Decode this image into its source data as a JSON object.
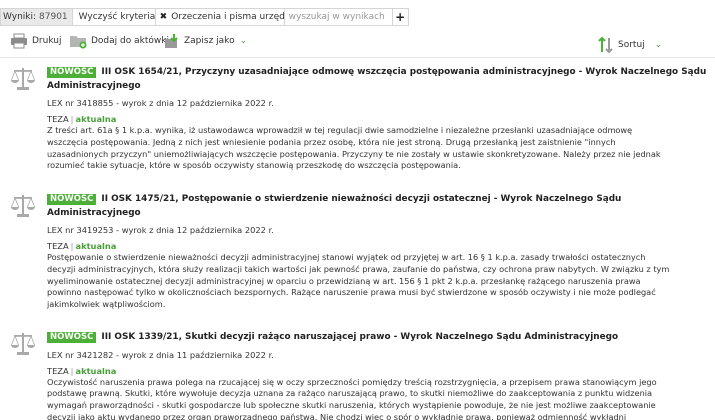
{
  "filterbar": {
    "results_label": "Wyniki:",
    "results_count": "87901",
    "clear_label": "Wyczyść kryteria",
    "tag_label": "Orzeczenia i pisma urzędowe",
    "search_placeholder": "wyszukaj w wynikach",
    "add_label": "+"
  },
  "toolbar": {
    "print_label": "Drukuj",
    "add_label": "Dodaj do aktówki",
    "save_label": "Zapisz jako",
    "sort_label": "Sortuj"
  },
  "results": [
    {
      "badge": "NOWOŚĆ",
      "title_line1": "III OSK 1654/21, Przyczyny uzasadniające odmowę wszczęcia postępowania administracyjnego - Wyrok Naczelnego Sądu",
      "title_line2": "Administracyjnego",
      "meta": "LEX nr 3418855 - wyrok z dnia 12 października 2022 r.",
      "source": "TEZA",
      "status": "aktualna",
      "abstract": [
        "Z treści art. 61a § 1 k.p.a. wynika, iż ustawodawca wprowadził w tej regulacji dwie samodzielne i niezależne przesłanki uzasadniające odmowę",
        "wszczęcia postępowania. Jedną z nich jest wniesienie podania przez osobę, która nie jest stroną. Drugą przesłanką jest zaistnienie \"innych",
        "uzasadnionych przyczyn\" uniemożliwiających wszczęcie postępowania. Przyczyny te nie zostały w ustawie skonkretyzowane. Należy przez nie jednak",
        "rozumieć takie sytuacje, które w sposób oczywisty stanowią przeszkodę do wszczęcia postępowania."
      ]
    },
    {
      "badge": "NOWOŚĆ",
      "title_line1": "II OSK 1475/21, Postępowanie o stwierdzenie nieważności decyzji ostatecznej - Wyrok Naczelnego Sądu",
      "title_line2": "Administracyjnego",
      "meta": "LEX nr 3419253 - wyrok z dnia 12 października 2022 r.",
      "source": "TEZA",
      "status": "aktualna",
      "abstract": [
        "Postępowanie o stwierdzenie nieważności decyzji administracyjnej stanowi wyjątek od przyjętej w art. 16 § 1 k.p.a. zasady trwałości ostatecznych",
        "decyzji administracyjnych, która służy realizacji takich wartości jak pewność prawa, zaufanie do państwa, czy ochrona praw nabytych. W związku z tym",
        "wyeliminowanie ostatecznej decyzji administracyjnej w oparciu o przewidzianą w art. 156 § 1 pkt 2 k.p.a. przesłankę rażącego naruszenia prawa",
        "powinno następować tylko w okolicznościach bezspornych. Rażące naruszenie prawa musi być stwierdzone w sposób oczywisty i nie może podlegać",
        "jakimkolwiek wątpliwościom."
      ]
    },
    {
      "badge": "NOWOŚĆ",
      "title_line1": "III OSK 1339/21, Skutki decyzji rażąco naruszającej prawo - Wyrok Naczelnego Sądu Administracyjnego",
      "title_line2": "",
      "meta": "LEX nr 3421282 - wyrok z dnia 11 października 2022 r.",
      "source": "TEZA",
      "status": "aktualna",
      "abstract": [
        "Oczywistość naruszenia prawa polega na rzucającej się w oczy sprzeczności pomiędzy treścią rozstrzygnięcia, a przepisem prawa stanowiącym jego",
        "podstawę prawną. Skutki, które wywołuje decyzja uznana za rażąco naruszającą prawo, to skutki niemożliwe do zaakceptowania z punktu widzenia",
        "wymagań praworządności - skutki gospodarcze lub społeczne skutki naruszenia, których wystąpienie powoduje, że nie jest możliwe zaakceptowanie",
        "decyzji jako aktu wydanego przez organ praworządnego państwa. Nie chodzi więc o spór o wykładnię prawa, ponieważ odmienność wykładni"
      ]
    }
  ]
}
